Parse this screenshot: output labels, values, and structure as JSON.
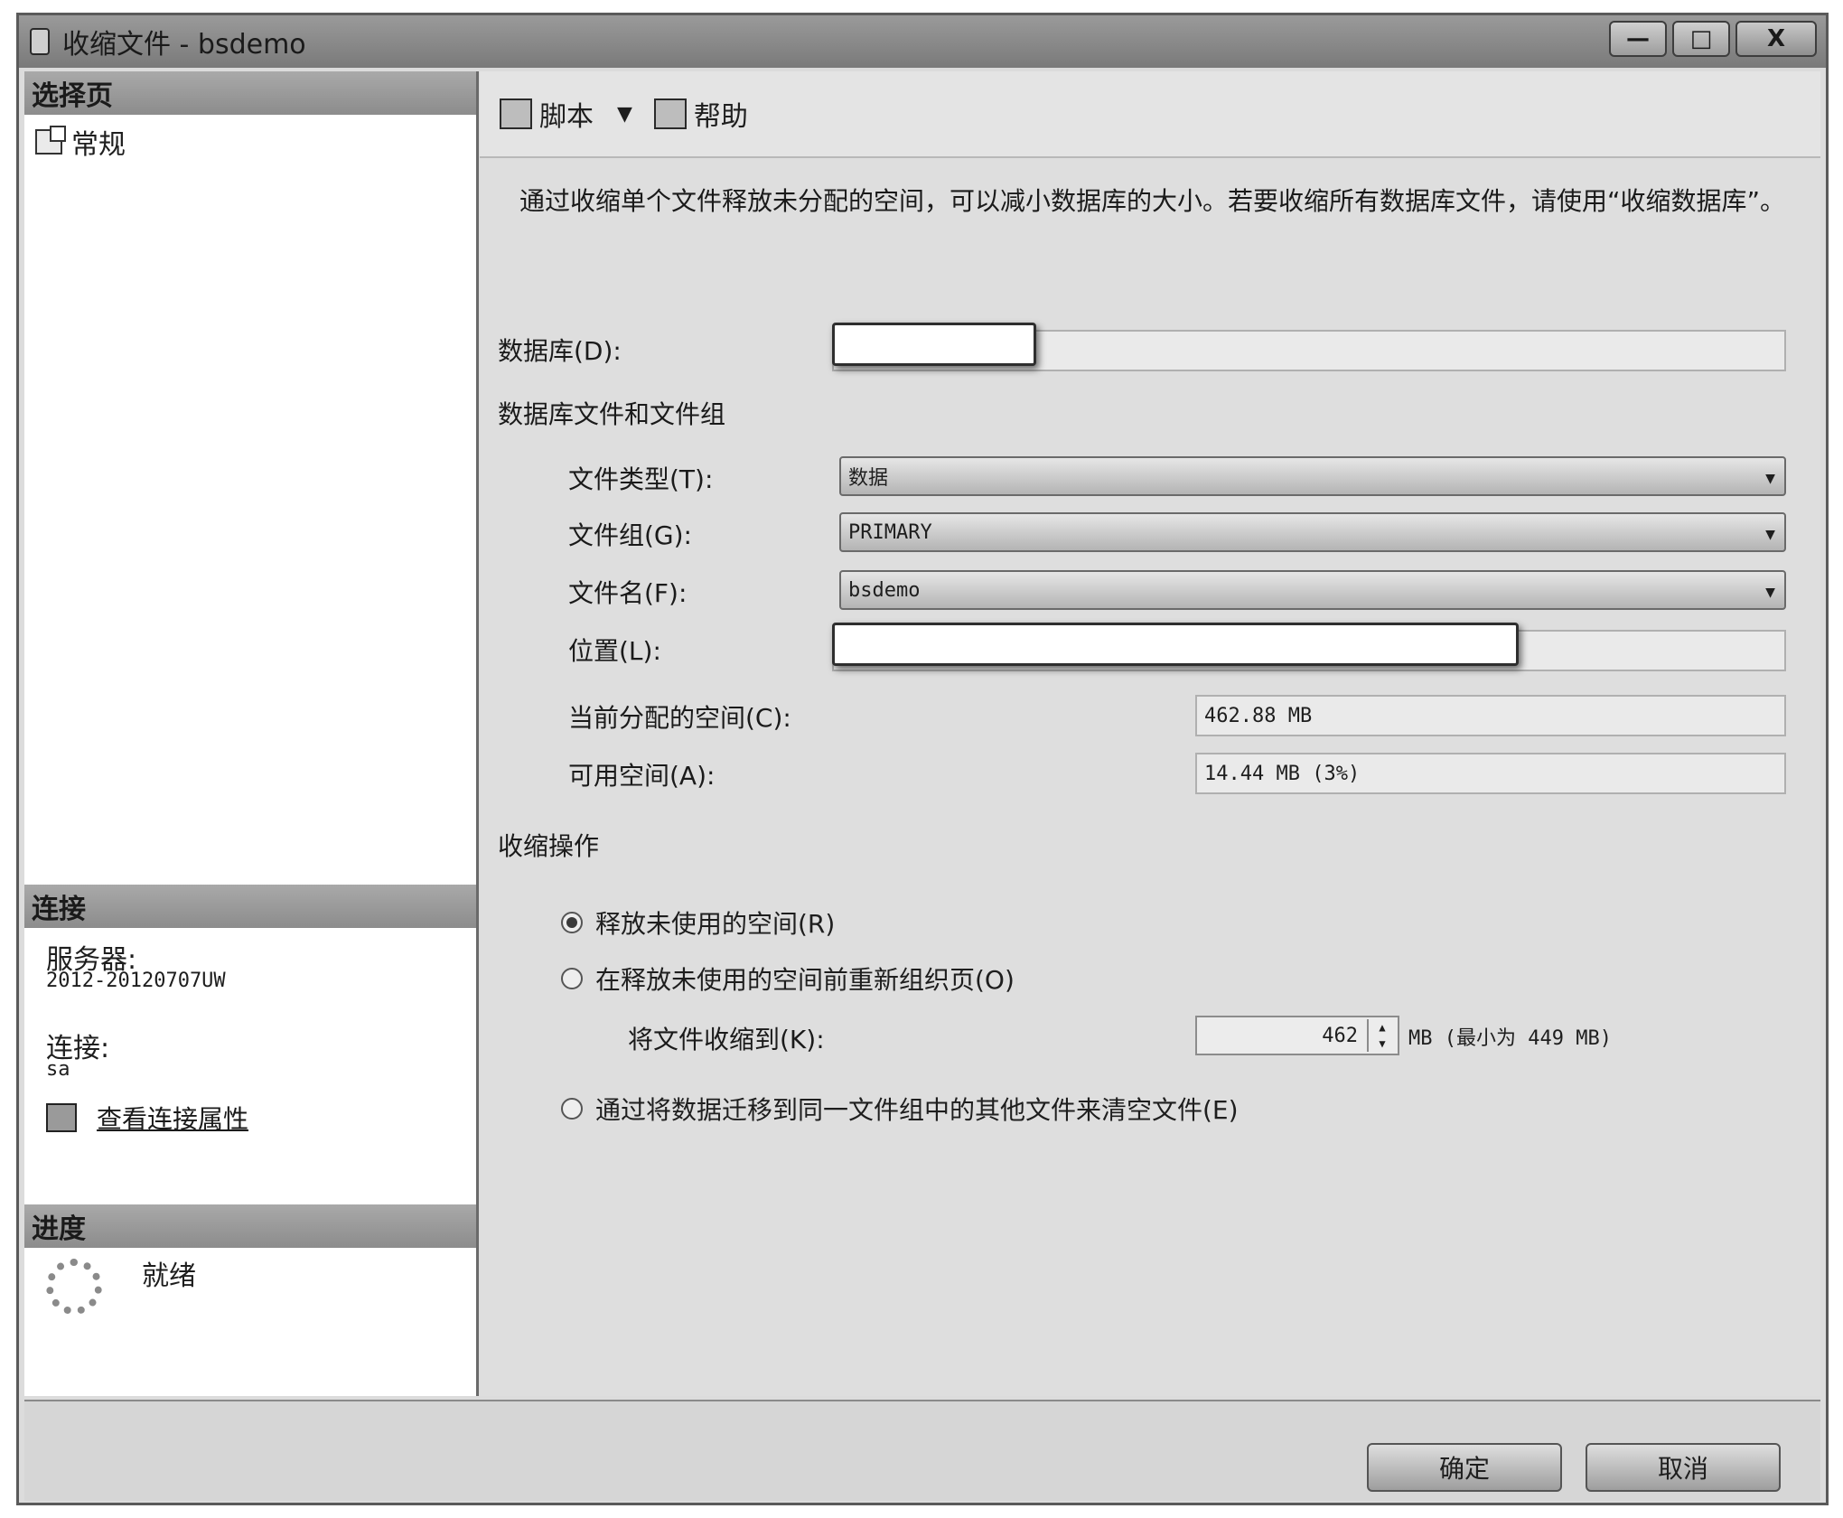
{
  "window": {
    "title": "收缩文件 - bsdemo",
    "controls": {
      "minimize": "—",
      "maximize": "□",
      "close": "X"
    }
  },
  "left": {
    "select_page_header": "选择页",
    "nav": [
      {
        "label": "常规",
        "icon": "general-page-icon"
      }
    ],
    "connection": {
      "header": "连接",
      "server_label": "服务器:",
      "server_value": "2012-20120707UW",
      "connection_label": "连接:",
      "connection_value": "sa",
      "view_props_link": "查看连接属性"
    },
    "progress": {
      "header": "进度",
      "status": "就绪"
    }
  },
  "toolbar": {
    "script_label": "脚本",
    "help_label": "帮助"
  },
  "main": {
    "description": "通过收缩单个文件释放未分配的空间，可以减小数据库的大小。若要收缩所有数据库文件，请使用“收缩数据库”。",
    "database_label": "数据库(D):",
    "files_group_title": "数据库文件和文件组",
    "file_type_label": "文件类型(T):",
    "file_type_value": "数据",
    "filegroup_label": "文件组(G):",
    "filegroup_value": "PRIMARY",
    "file_name_label": "文件名(F):",
    "file_name_value": "bsdemo",
    "location_label": "位置(L):",
    "allocated_label": "当前分配的空间(C):",
    "allocated_value": "462.88 MB",
    "available_label": "可用空间(A):",
    "available_value": "14.44 MB (3%)",
    "shrink_action_title": "收缩操作",
    "option_release": "释放未使用的空间(R)",
    "option_reorganize": "在释放未使用的空间前重新组织页(O)",
    "shrink_to_label": "将文件收缩到(K):",
    "shrink_to_value": "462",
    "shrink_to_unit": "MB (最小为 449 MB)",
    "option_empty": "通过将数据迁移到同一文件组中的其他文件来清空文件(E)"
  },
  "buttons": {
    "ok": "确定",
    "cancel": "取消"
  }
}
